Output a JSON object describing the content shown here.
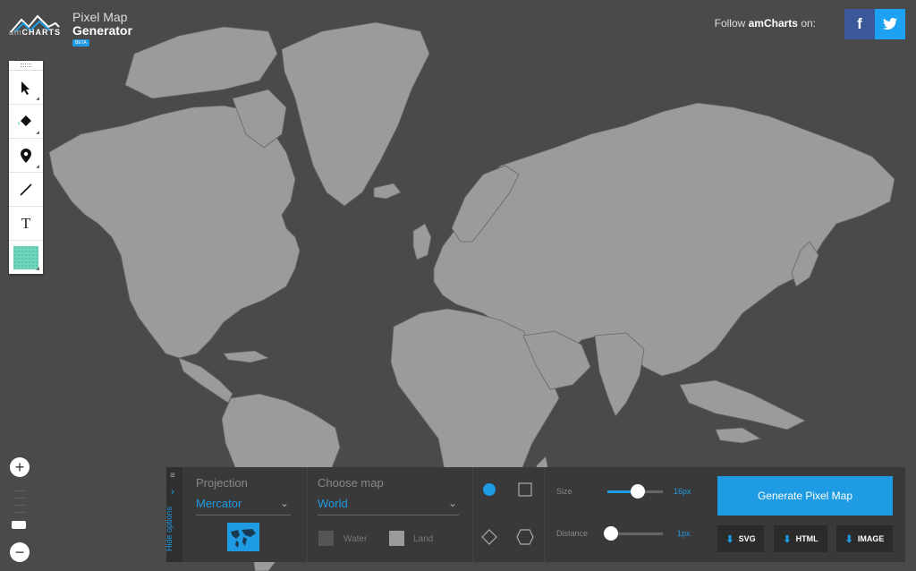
{
  "header": {
    "logo_prefix": "am",
    "logo_brand": "CHARTS",
    "title_line1": "Pixel Map",
    "title_line2": "Generator",
    "badge": "BETA",
    "follow_prefix": "Follow ",
    "follow_brand": "amCharts",
    "follow_suffix": " on:"
  },
  "toolbox": {
    "text_tool": "T",
    "swatch_color": "#6fd6be"
  },
  "icons": {
    "facebook": "f"
  },
  "zoom": {
    "in_label": "+",
    "out_label": "−"
  },
  "options": {
    "hide_label": "Hide options",
    "projection_label": "Projection",
    "projection_value": "Mercator",
    "map_label": "Choose map",
    "map_value": "World",
    "water_label": "Water",
    "land_label": "Land",
    "size_label": "Size",
    "size_value": "16px",
    "size_level": 0.55,
    "distance_label": "Distance",
    "distance_value": "1px",
    "distance_level": 0.0
  },
  "actions": {
    "generate": "Generate Pixel Map",
    "svg": "SVG",
    "html": "HTML",
    "image": "IMAGE"
  },
  "colors": {
    "accent": "#1e9be2",
    "background": "#4a4a4a",
    "land": "#9b9b9b",
    "water_swatch": "#555555",
    "land_swatch": "#9b9b9b",
    "facebook": "#3b5998",
    "twitter": "#1da1f2"
  }
}
